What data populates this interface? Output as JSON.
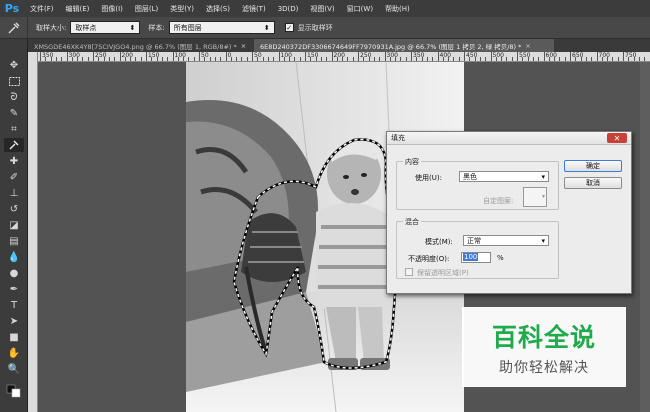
{
  "app": {
    "logo": "Ps"
  },
  "menu": [
    "文件(F)",
    "编辑(E)",
    "图像(I)",
    "图层(L)",
    "类型(Y)",
    "选择(S)",
    "滤镜(T)",
    "3D(D)",
    "视图(V)",
    "窗口(W)",
    "帮助(H)"
  ],
  "options": {
    "sample_size_label": "取样大小:",
    "sample_size_value": "取样点",
    "sample_label": "样本:",
    "sample_value": "所有图层",
    "show_ring_label": "显示取样环"
  },
  "tabs": [
    {
      "label": "XMSGDE46XK4Y8[7SCIVJGO4.png @ 66.7% (图层 1, RGB/8#) *",
      "active": false
    },
    {
      "label": "6E8D240372DF3306674649FF7970931A.jpg @ 66.7% (图层 1 拷贝 2, 绿 拷贝/8) *",
      "active": true
    }
  ],
  "ruler": [
    "350",
    "300",
    "250",
    "200",
    "150",
    "100",
    "50",
    "0",
    "50",
    "100",
    "150",
    "200",
    "250",
    "300",
    "350",
    "400",
    "450",
    "500",
    "550",
    "600",
    "650",
    "700",
    "750"
  ],
  "dialog": {
    "title": "填充",
    "content_group": "内容",
    "use_label": "使用(U):",
    "use_value": "黑色",
    "custom_pattern_label": "自定图案:",
    "blend_group": "混合",
    "mode_label": "模式(M):",
    "mode_value": "正常",
    "opacity_label": "不透明度(O):",
    "opacity_value": "100",
    "opacity_unit": "%",
    "preserve_label": "保留透明区域(P)",
    "ok": "确定",
    "cancel": "取消"
  },
  "watermark": {
    "main": "百科全说",
    "sub": "助你轻松解决"
  },
  "tools": [
    "move-tool-icon",
    "marquee-tool-icon",
    "lasso-tool-icon",
    "quick-select-tool-icon",
    "crop-tool-icon",
    "eyedropper-tool-icon",
    "healing-brush-tool-icon",
    "brush-tool-icon",
    "clone-stamp-tool-icon",
    "history-brush-tool-icon",
    "eraser-tool-icon",
    "gradient-tool-icon",
    "blur-tool-icon",
    "dodge-tool-icon",
    "pen-tool-icon",
    "type-tool-icon",
    "path-select-tool-icon",
    "shape-tool-icon",
    "hand-tool-icon",
    "zoom-tool-icon"
  ]
}
